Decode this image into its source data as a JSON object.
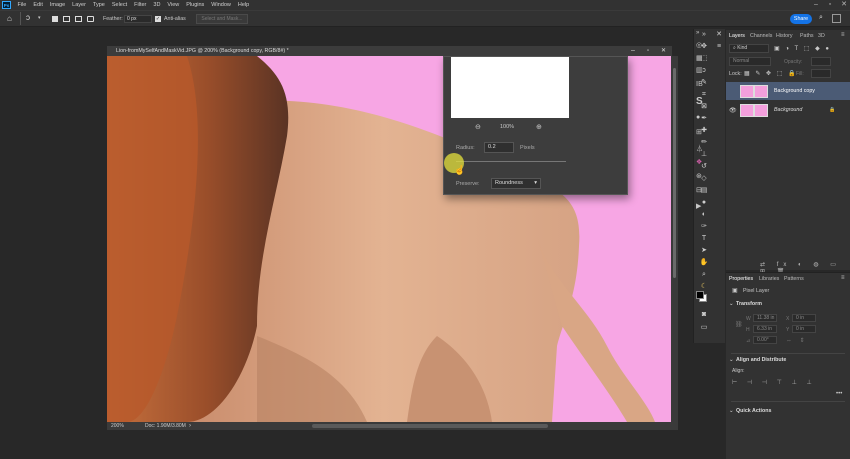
{
  "menubar": {
    "items": [
      "File",
      "Edit",
      "Image",
      "Layer",
      "Type",
      "Select",
      "Filter",
      "3D",
      "View",
      "Plugins",
      "Window",
      "Help"
    ],
    "share_label": "Share"
  },
  "options": {
    "feather_label": "Feather:",
    "feather_value": "0 px",
    "antialias_label": "Anti-alias",
    "select_mask_label": "Select and Mask..."
  },
  "document": {
    "tab_title": "Lion-fromMySelfAndMaskVid.JPG @ 200% (Background copy, RGB/8#) *",
    "zoom": "200%",
    "doc_info": "Doc: 1.90M/3.80M"
  },
  "dialog": {
    "zoom_label": "100%",
    "radius_label": "Radius:",
    "radius_value": "0.2",
    "radius_unit": "Pixels",
    "preserve_label": "Preserve:",
    "preserve_value": "Roundness"
  },
  "layers_panel": {
    "tabs": [
      "Layers",
      "Channels",
      "History",
      "Paths",
      "3D"
    ],
    "kind_label": "Kind",
    "blend_mode": "Normal",
    "opacity_label": "Opacity:",
    "opacity_value": "",
    "lock_label": "Lock:",
    "fill_label": "Fill:",
    "layers": [
      {
        "name": "Background copy"
      },
      {
        "name": "Background"
      }
    ]
  },
  "properties_panel": {
    "tabs": [
      "Properties",
      "Libraries",
      "Patterns"
    ],
    "layer_type": "Pixel Layer",
    "transform_label": "Transform",
    "w_label": "W",
    "w_value": "11.38 in",
    "x_label": "X",
    "x_value": "0 in",
    "h_label": "H",
    "h_value": "6.33 in",
    "y_label": "Y",
    "y_value": "0 in",
    "angle_value": "0.00°",
    "align_label": "Align and Distribute",
    "align_sub": "Align:",
    "quick_actions_label": "Quick Actions"
  },
  "colors": {
    "canvas_bg": "#f7a6e4",
    "accent": "#1473e6",
    "selection_row": "#4b5b75"
  }
}
